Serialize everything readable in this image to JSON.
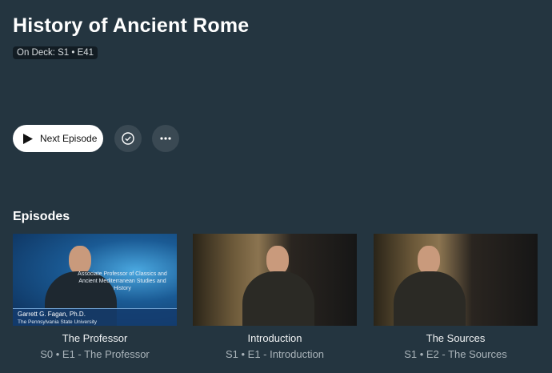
{
  "show": {
    "title": "History of Ancient Rome",
    "on_deck": "On Deck: S1 • E41"
  },
  "actions": {
    "next_episode": "Next Episode",
    "mark_watched_icon": "check-circle-icon",
    "more_icon": "ellipsis-icon"
  },
  "episodes_heading": "Episodes",
  "episodes": [
    {
      "title": "The Professor",
      "subtitle": "S0 • E1 - The Professor",
      "thumb_caption": "Associate Professor of Classics and Ancient Mediterranean Studies and History",
      "thumb_name": "Garrett G. Fagan, Ph.D.",
      "thumb_affil": "The Pennsylvania State University"
    },
    {
      "title": "Introduction",
      "subtitle": "S1 • E1 - Introduction"
    },
    {
      "title": "The Sources",
      "subtitle": "S1 • E2 - The Sources"
    }
  ],
  "colors": {
    "background": "#243540",
    "button_bg": "#ffffff",
    "icon_button_bg": "#3a4953"
  }
}
